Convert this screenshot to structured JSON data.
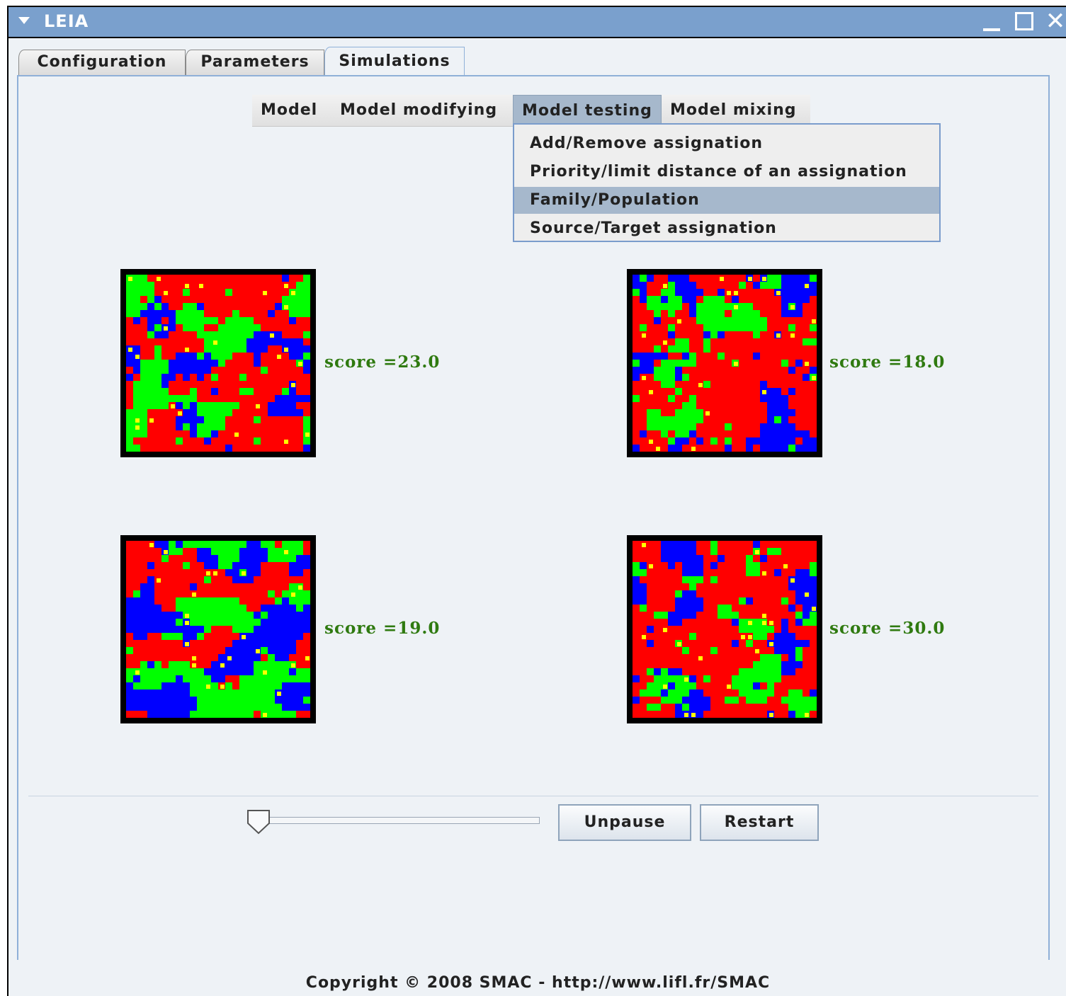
{
  "window": {
    "title": "LEIA"
  },
  "tabs": [
    {
      "label": "Configuration"
    },
    {
      "label": "Parameters"
    },
    {
      "label": "Simulations",
      "active": true
    }
  ],
  "menubar": [
    {
      "label": "Model"
    },
    {
      "label": "Model modifying"
    },
    {
      "label": "Model testing",
      "open": true
    },
    {
      "label": "Model mixing"
    }
  ],
  "dropdown": [
    {
      "label": "Add/Remove assignation"
    },
    {
      "label": "Priority/limit distance of an assignation"
    },
    {
      "label": "Family/Population",
      "highlighted": true
    },
    {
      "label": "Source/Target assignation"
    }
  ],
  "simulations": [
    {
      "score": "score =23.0"
    },
    {
      "score": "score =18.0"
    },
    {
      "score": "score =19.0"
    },
    {
      "score": "score =30.0"
    }
  ],
  "colors": {
    "cell_red": "#ff0000",
    "cell_green": "#00ff00",
    "cell_blue": "#0000ff",
    "cell_yellow": "#ffff00",
    "score_text": "#2f7a10",
    "title_bar": "#7aa0cd"
  },
  "controls": {
    "slider_value": 0,
    "unpause_label": "Unpause",
    "restart_label": "Restart"
  },
  "footer": {
    "text": "Copyright © 2008 SMAC - http://www.lifl.fr/SMAC"
  },
  "icons": [
    "menu-triangle-icon",
    "minimize-icon",
    "maximize-icon",
    "close-icon",
    "slider-knob-icon"
  ]
}
